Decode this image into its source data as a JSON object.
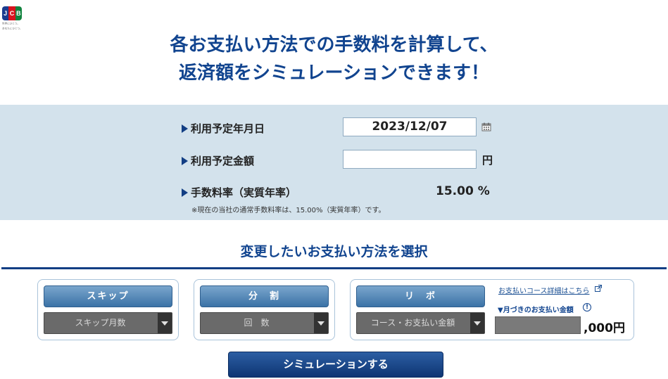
{
  "logo": {
    "tagline_1": "世界にひとつ。",
    "tagline_2": "あなたにひとつ。"
  },
  "headline": {
    "line1": "各お支払い方法での手数料を計算して、",
    "line2": "返済額をシミュレーションできます！"
  },
  "form": {
    "date_label": "利用予定年月日",
    "date_value": "2023/12/07",
    "amount_label": "利用予定金額",
    "amount_value": "",
    "amount_unit": "円",
    "rate_label": "手数料率（実質年率）",
    "rate_value": "15.00 %",
    "rate_note": "※現在の当社の通常手数料率は、15.00%（実質年率）です。"
  },
  "payment": {
    "section_title": "変更したいお支払い方法を選択",
    "skip": {
      "button_label": "スキップ",
      "select_value": "スキップ月数"
    },
    "installment": {
      "button_label": "分　割",
      "select_value": "回　数"
    },
    "revolving": {
      "button_label": "リ　ボ",
      "select_value": "コース・お支払い金額",
      "course_link": "お支払いコース詳細はこちら",
      "monthly_label": "▼月づきのお支払い金額",
      "monthly_value": "",
      "monthly_suffix": ",000円"
    }
  },
  "simulate_button": "シミュレーションする",
  "colors": {
    "brand_blue": "#11448f",
    "panel_bg": "#d3e2ec",
    "button_blue": "#3b72a6"
  }
}
